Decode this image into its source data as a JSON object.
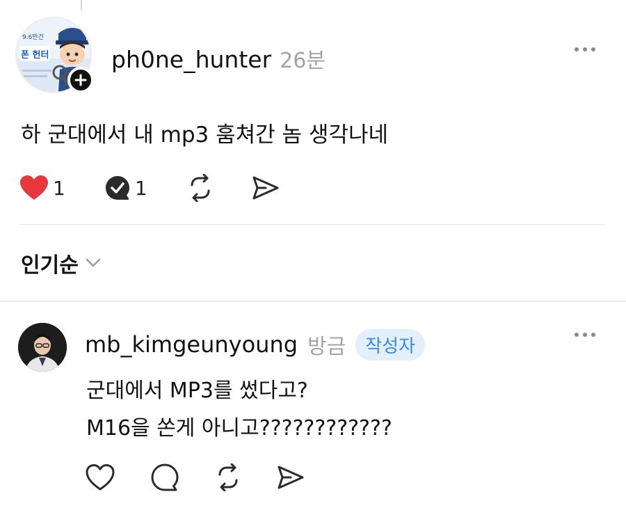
{
  "post": {
    "avatar_badge_text": "폰 헌터",
    "avatar_top_text": "9.6만건",
    "username": "ph0ne_hunter",
    "time": "26분",
    "text": "하 군대에서 내 mp3 훔쳐간 놈 생각나네",
    "likes": "1",
    "replies": "1",
    "icons": {
      "like": "heart-filled-icon",
      "reply": "reply-check-icon",
      "repost": "repost-icon",
      "share": "send-icon",
      "more": "more-dots-icon",
      "follow": "plus-icon"
    },
    "colors": {
      "like": "#e8383d",
      "reply": "#2b2b2b"
    }
  },
  "sort": {
    "label": "인기순",
    "icon": "chevron-down-icon"
  },
  "reply": {
    "username": "mb_kimgeunyoung",
    "time": "방금",
    "badge": "작성자",
    "line1": "군대에서 MP3를 썼다고?",
    "line2": "M16을 쏜게 아니고????????????",
    "icons": {
      "like": "heart-outline-icon",
      "comment": "comment-icon",
      "repost": "repost-icon",
      "share": "send-icon",
      "more": "more-dots-icon"
    },
    "colors": {
      "badge_bg": "#e3f0fc",
      "badge_text": "#3a8be0"
    }
  }
}
